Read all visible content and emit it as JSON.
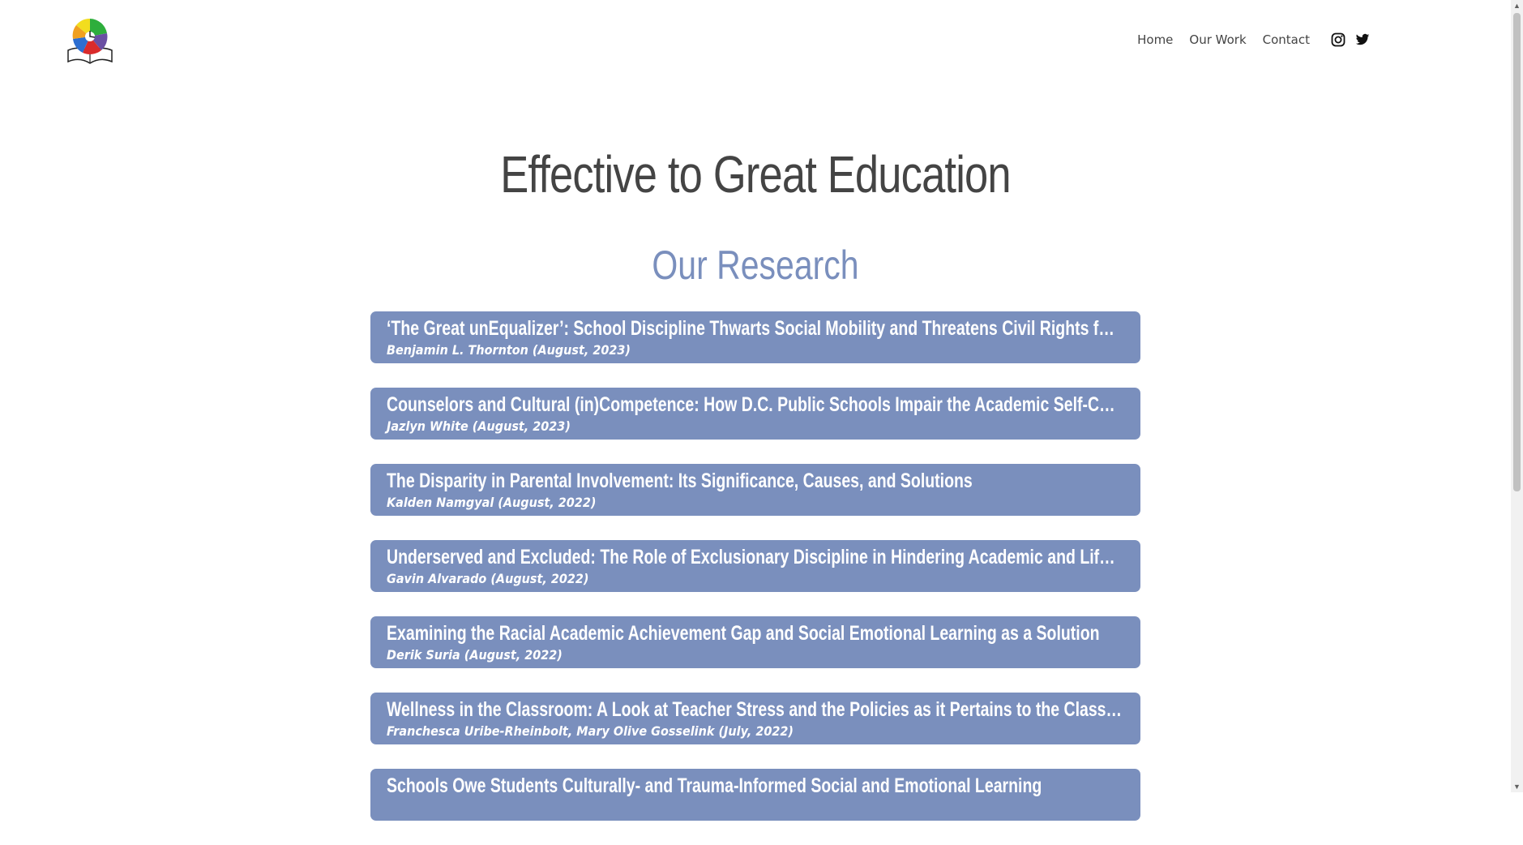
{
  "nav": {
    "items": [
      {
        "label": "Home"
      },
      {
        "label": "Our Work"
      },
      {
        "label": "Contact"
      }
    ],
    "social": [
      "instagram-icon",
      "twitter-icon"
    ]
  },
  "site_title": "Effective to Great Education",
  "section_title": "Our Research",
  "research": [
    {
      "title": "‘The Great unEqualizer’: School Discipline Thwarts Social Mobility and Threatens Civil Rights for Low-Income Students",
      "meta": "Benjamin L. Thornton (August, 2023)"
    },
    {
      "title": "Counselors and Cultural (in)Competence: How D.C. Public Schools Impair the Academic Self-Concepts of Students of Color",
      "meta": "Jazlyn White (August, 2023)"
    },
    {
      "title": "The Disparity in Parental Involvement: Its Significance, Causes, and Solutions",
      "meta": "Kalden Namgyal (August, 2022)"
    },
    {
      "title": "Underserved and Excluded: The Role of Exclusionary Discipline in Hindering Academic and Life Outcomes, and Solutions",
      "meta": "Gavin Alvarado (August, 2022)"
    },
    {
      "title": "Examining the Racial Academic Achievement Gap and Social Emotional Learning as a Solution",
      "meta": "Derik Suria (August, 2022)"
    },
    {
      "title": "Wellness in the Classroom: A Look at Teacher Stress and the Policies as it Pertains to the Classroom",
      "meta": "Franchesca Uribe-Rheinbolt, Mary Olive Gosselink (July, 2022)"
    },
    {
      "title": "Schools Owe Students Culturally- and Trauma-Informed Social and Emotional Learning",
      "meta": ""
    }
  ],
  "colors": {
    "accent": "#7a8fbd",
    "text": "#444444",
    "card_text": "#ffffff"
  }
}
